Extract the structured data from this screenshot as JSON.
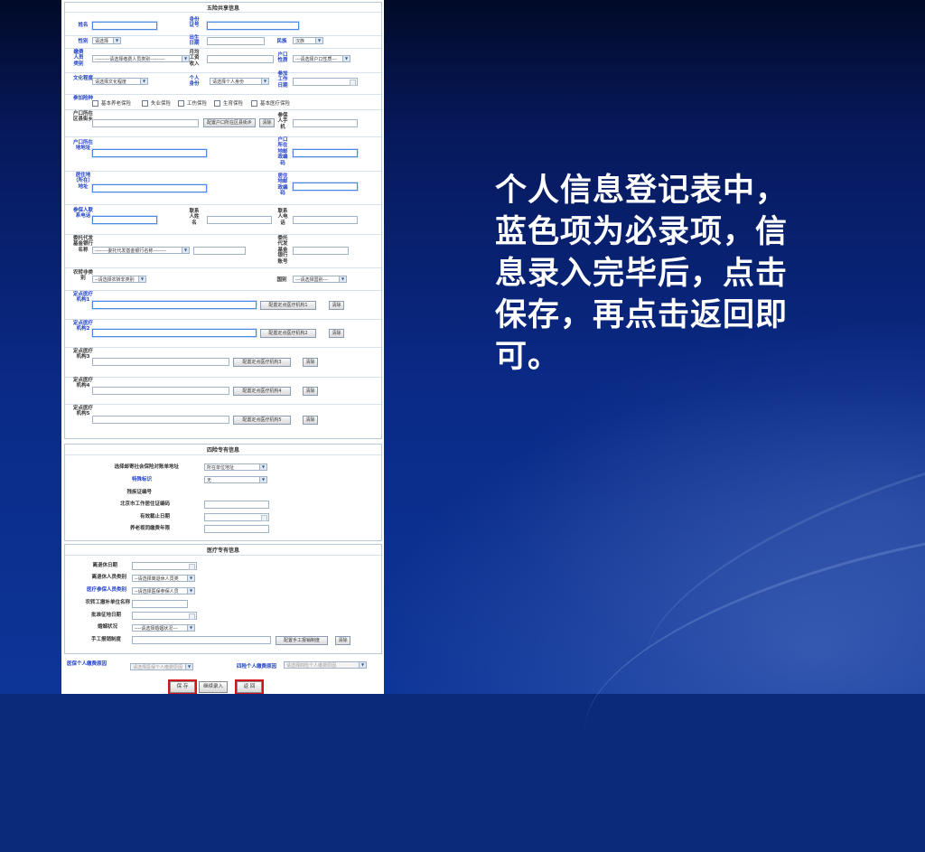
{
  "caption": "个人信息登记表中，蓝色项为必录项，信息录入完毕后，点击保存，再点击返回即可。",
  "form": {
    "section1": {
      "title": "五险共享信息",
      "name_label": "姓名",
      "id_label": "身份证号",
      "gender_label": "性别",
      "gender_value": "请选择",
      "birth_label": "出生日期",
      "ethnic_label": "民族",
      "ethnic_value": "汉族",
      "payer_type_label": "缴费人员类别",
      "payer_type_value": "---------请选择缴费人员类别---------",
      "avg_wage_label": "月均工资收入",
      "hukou_nature_label": "户口性质",
      "hukou_nature_value": "---请选择户口性质---",
      "edu_label": "文化程度",
      "edu_value": "请选择文化程度",
      "identity_label": "个人身份",
      "identity_value": "请选择个人身份",
      "work_date_label": "参加工作日期",
      "ins_type_label": "参加险种",
      "ins_types": [
        "基本养老保险",
        "失业保险",
        "工伤保险",
        "生育保险",
        "基本医疗保险"
      ],
      "hukou_district_label": "户口所在区县街乡",
      "config_hukou_button": "配置户口所在区县街乡",
      "delete_label": "清除",
      "mobile_label": "参保人手机",
      "hukou_addr_label": "户口所在地地址",
      "hukou_zip_label": "户口所在地邮政编码",
      "residence_addr_label": "居住地（所在）地址",
      "residence_zip_label": "居住地邮政编码",
      "contact_phone_label": "参保人联系电话",
      "contact_name_label": "联系人姓名",
      "contact_tel_label": "联系人电话",
      "bank_name_label": "委托代发基金银行名称",
      "bank_name_value": "--------委托代发基金银行名称--------",
      "bank_acct_label": "委托代发基金银行账号",
      "rural_label": "农转非类别",
      "rural_value": "--请选择农转非类别",
      "country_label": "国别",
      "country_value": "---请选择国别---",
      "hospital_labels": [
        "定点医疗机构1",
        "定点医疗机构2",
        "定点医疗机构3",
        "定点医疗机构4",
        "定点医疗机构5"
      ],
      "hospital_buttons": [
        "配置定点医疗机构1",
        "配置定点医疗机构2",
        "配置定点医疗机构3",
        "配置定点医疗机构4",
        "配置定点医疗机构5"
      ]
    },
    "section2": {
      "title": "四险专有信息",
      "mail_label": "选择邮寄社会保险对账单地址",
      "mail_value": "所在单位地址",
      "special_label": "特殊标识",
      "special_value": "无",
      "border_label": "残疾证编号",
      "beijing_label": "北京市工作居住证编码",
      "valid_label": "有效截止日期",
      "pension_label": "养老视同缴费年限"
    },
    "section3": {
      "title": "医疗专有信息",
      "retire_date_label": "离退休日期",
      "retire_type_label": "离退休人员类别",
      "retire_type_value": "--请选择离退休人员类",
      "med_type_label": "医疗参保人员类别",
      "med_type_value": "--请选择医保参保人员",
      "rural_unit_label": "农转工撤补单位名称",
      "approve_label": "批准征地日期",
      "marriage_label": "婚姻状况",
      "marriage_value": "----请选择婚姻状况---",
      "manual_label": "手工报销制度",
      "manual_button": "配置手工报销制度",
      "delete_label": "清除"
    },
    "footer": {
      "med_reason_label": "医保个人缴费原因",
      "med_reason_value": "请选择医保个人缴费原因",
      "four_reason_label": "四险个人缴费原因",
      "four_reason_value": "请选择四险个人缴费原因",
      "save_button": "保 存",
      "continue_button": "继续录入",
      "back_button": "返 回"
    }
  }
}
